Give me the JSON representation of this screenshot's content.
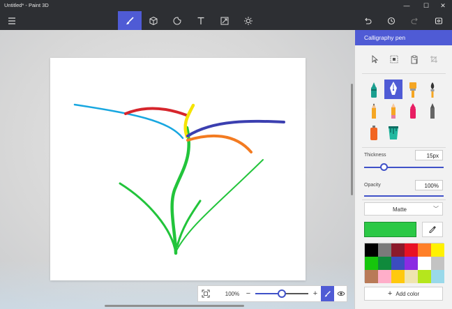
{
  "window": {
    "title": "Untitled* - Paint 3D",
    "minimize_glyph": "—",
    "maximize_glyph": "☐",
    "close_glyph": "✕"
  },
  "toolbar": {
    "active_tool": "Art tools",
    "tools": [
      {
        "name": "menu-icon"
      },
      {
        "name": "brush-icon"
      },
      {
        "name": "3d-cube-icon"
      },
      {
        "name": "stickers-icon"
      },
      {
        "name": "text-icon"
      },
      {
        "name": "canvas-icon"
      },
      {
        "name": "effects-icon"
      },
      {
        "name": "undo-icon"
      },
      {
        "name": "history-icon"
      },
      {
        "name": "redo-icon"
      },
      {
        "name": "view-3d-icon"
      }
    ]
  },
  "panel": {
    "title": "Calligraphy pen",
    "brushes": [
      {
        "name": "marker",
        "selected": false
      },
      {
        "name": "calligraphy-pen",
        "selected": true
      },
      {
        "name": "oil-brush",
        "selected": false
      },
      {
        "name": "watercolor",
        "selected": false
      },
      {
        "name": "pixel-pen",
        "selected": false
      },
      {
        "name": "pencil",
        "selected": false
      },
      {
        "name": "eraser",
        "selected": false
      },
      {
        "name": "crayon",
        "selected": false
      },
      {
        "name": "spray-can",
        "selected": false
      },
      {
        "name": "fill",
        "selected": false
      }
    ],
    "thickness_label": "Thickness",
    "thickness_value": "15px",
    "thickness_fraction": 0.25,
    "opacity_label": "Opacity",
    "opacity_value": "100%",
    "opacity_fraction": 1.0,
    "finish_value": "Matte",
    "current_color": "#2bc845",
    "palette": [
      "#000000",
      "#7a7a7a",
      "#8b1a2b",
      "#e81123",
      "#ff7f27",
      "#fff100",
      "#16c60c",
      "#0f8a3c",
      "#3b4cc0",
      "#8a2be2",
      "#ffffff",
      "#c3c3c3",
      "#b97a57",
      "#ffaec9",
      "#ffc90e",
      "#efe4b0",
      "#b5e61d",
      "#99d9ea"
    ],
    "add_color_label": "Add color",
    "add_glyph": "+"
  },
  "zoom": {
    "percent_label": "100%",
    "slider_fraction": 0.5,
    "minus_glyph": "−",
    "plus_glyph": "+"
  },
  "colors": {
    "accent": "#4f5bd5",
    "titlebar": "#2d2f33"
  }
}
